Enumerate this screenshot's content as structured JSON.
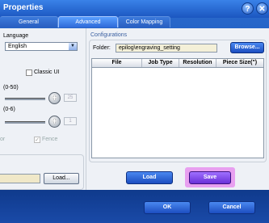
{
  "window": {
    "title": "Properties",
    "help_icon": "?",
    "close_icon": "✕"
  },
  "tabs": [
    {
      "label": "General"
    },
    {
      "label": "Advanced"
    },
    {
      "label": "Color Mapping"
    }
  ],
  "left": {
    "language_label": "Language",
    "language_value": "English",
    "classic_ui_label": "Classic UI",
    "slider1_label": "(0-50)",
    "slider1_value": "25",
    "slider2_label": "(0-6)",
    "slider2_value": "1",
    "trunc_label": "or",
    "fence_label": "Fence",
    "load_button": "Load..."
  },
  "configurations": {
    "group_label": "Configurations",
    "folder_label": "Folder:",
    "folder_value": "epilog\\engraving_setting",
    "browse_button": "Browse...",
    "columns": [
      "File",
      "Job Type",
      "Resolution",
      "Piece Size(\")"
    ]
  },
  "actions": {
    "load": "Load",
    "save": "Save"
  },
  "footer": {
    "ok": "OK",
    "cancel": "Cancel"
  }
}
